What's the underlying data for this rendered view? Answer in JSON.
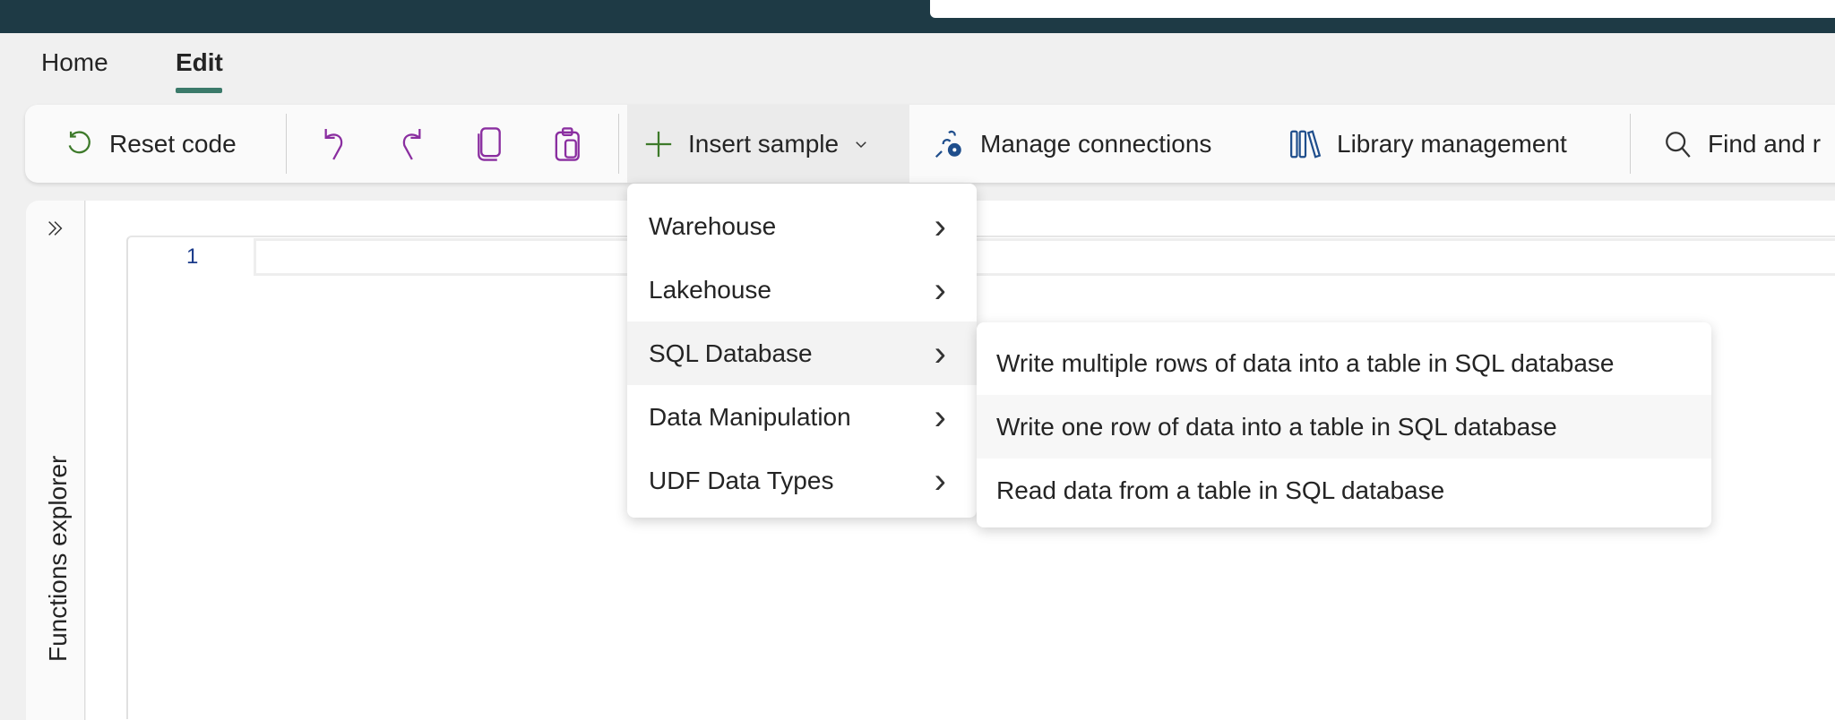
{
  "header": {
    "search_placeholder": ""
  },
  "tabs": [
    {
      "label": "Home",
      "active": false
    },
    {
      "label": "Edit",
      "active": true
    }
  ],
  "toolbar": {
    "reset_code": "Reset code",
    "insert_sample": "Insert sample",
    "manage_connections": "Manage connections",
    "library_management": "Library management",
    "find_and_replace": "Find and r"
  },
  "sidebar": {
    "label": "Functions explorer"
  },
  "editor": {
    "line_numbers": [
      "1"
    ]
  },
  "insert_menu": {
    "items": [
      {
        "label": "Warehouse"
      },
      {
        "label": "Lakehouse"
      },
      {
        "label": "SQL Database",
        "active": true
      },
      {
        "label": "Data Manipulation"
      },
      {
        "label": "UDF Data Types"
      }
    ]
  },
  "sql_submenu": {
    "items": [
      {
        "label": "Write multiple rows of data into a table in SQL database"
      },
      {
        "label": "Write one row of data into a table in SQL database",
        "hover": true
      },
      {
        "label": "Read data from a table in SQL database"
      }
    ]
  },
  "colors": {
    "header_bg": "#1e3a45",
    "accent_underline": "#3b7a6a",
    "icon_purple": "#8a2ea0",
    "icon_green": "#3d7a2a",
    "icon_blue": "#1f4e8c"
  }
}
